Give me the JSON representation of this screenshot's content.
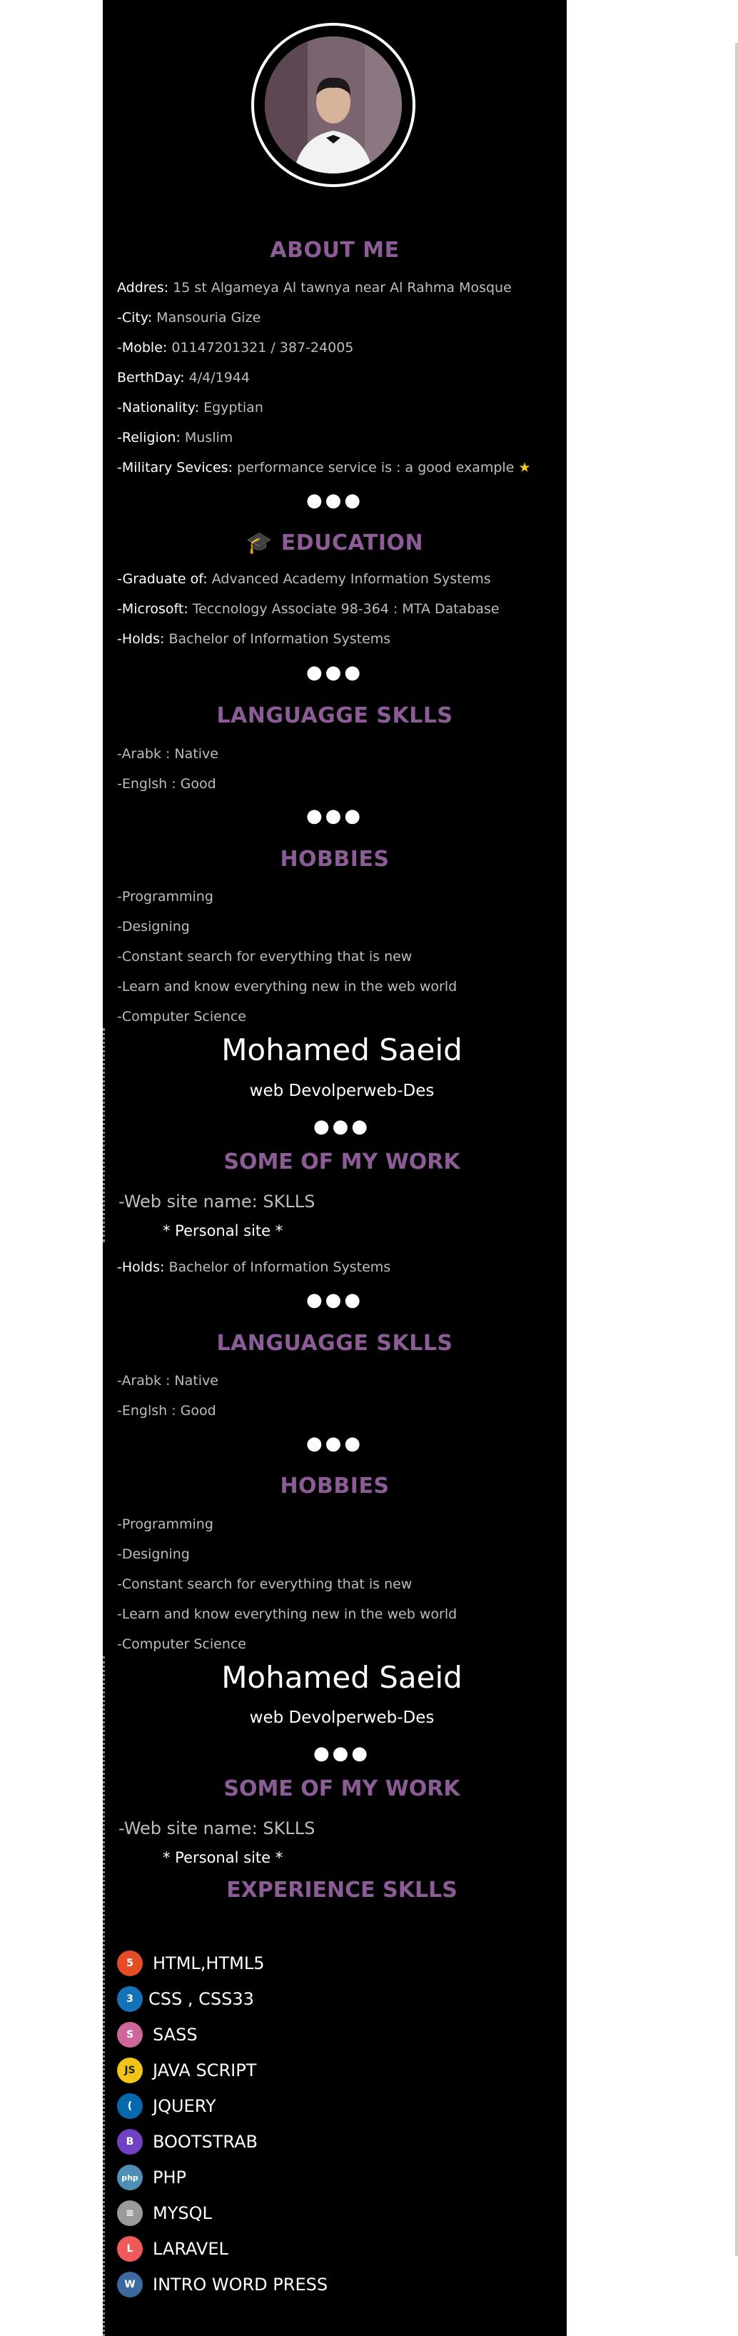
{
  "profile": {
    "name": "Mohamed Saeid",
    "subtitle": "web Devolperweb-Des"
  },
  "about": {
    "title": "ABOUT ME",
    "items": [
      {
        "key": "Addres:",
        "value": "15 st Algameya Al tawnya near Al Rahma Mosque"
      },
      {
        "key": "-City:",
        "value": "Mansouria Gize"
      },
      {
        "key": "-Moble:",
        "value": "01147201321 / 387-24005"
      },
      {
        "key": "BerthDay:",
        "value": "4/4/1944"
      },
      {
        "key": "-Nationality:",
        "value": "Egyptian"
      },
      {
        "key": "-Religion:",
        "value": "Muslim"
      },
      {
        "key": "-Military Sevices:",
        "value": "performance service is : a good example"
      }
    ]
  },
  "separator": "●●●",
  "education": {
    "title": "EDUCATION",
    "items": [
      {
        "key": "-Graduate of:",
        "value": "Advanced Academy Information Systems"
      },
      {
        "key": "-Microsoft:",
        "value": "Teccnology Associate 98-364 : MTA Database"
      },
      {
        "key": "-Holds:",
        "value": "Bachelor of Information Systems"
      }
    ]
  },
  "languages": {
    "title": "LANGUAGGE SKLLS",
    "items": [
      "-Arabk : Native",
      "-Englsh : Good"
    ]
  },
  "hobbies": {
    "title": "HOBBIES",
    "items": [
      "-Programming",
      "-Designing",
      "-Constant search for everything that is new",
      "-Learn and know everything new in the web world",
      "-Computer Science"
    ]
  },
  "work": {
    "title": "SOME OF MY WORK",
    "site": "-Web site name: SKLLS",
    "site_type": "* Personal site *",
    "holds_key": "-Holds:",
    "holds_value": "Bachelor of Information Systems"
  },
  "experience": {
    "title": "EXPERIENCE SKLLS",
    "items": [
      {
        "label": "HTML,HTML5",
        "icon": "html5-icon",
        "glyph": "5",
        "color": "#e44d26"
      },
      {
        "label": "CSS , CSS33",
        "icon": "css3-icon",
        "glyph": "3",
        "color": "#1572b6"
      },
      {
        "label": "SASS",
        "icon": "sass-icon",
        "glyph": "S",
        "color": "#cd6799"
      },
      {
        "label": "JAVA SCRIPT",
        "icon": "javascript-icon",
        "glyph": "JS",
        "color": "#f0c419"
      },
      {
        "label": "JQUERY",
        "icon": "jquery-icon",
        "glyph": "(",
        "color": "#0769ad"
      },
      {
        "label": "BOOTSTRAB",
        "icon": "bootstrap-icon",
        "glyph": "B",
        "color": "#6f42c1"
      },
      {
        "label": "PHP",
        "icon": "php-icon",
        "glyph": "php",
        "color": "#4f8fb6"
      },
      {
        "label": "MYSQL",
        "icon": "mysql-icon",
        "glyph": "≡",
        "color": "#9a9a9a"
      },
      {
        "label": "LARAVEL",
        "icon": "laravel-icon",
        "glyph": "L",
        "color": "#ef5b5b"
      },
      {
        "label": "INTRO WORD PRESS",
        "icon": "wordpress-icon",
        "glyph": "W",
        "color": "#3b6b9e"
      }
    ]
  }
}
